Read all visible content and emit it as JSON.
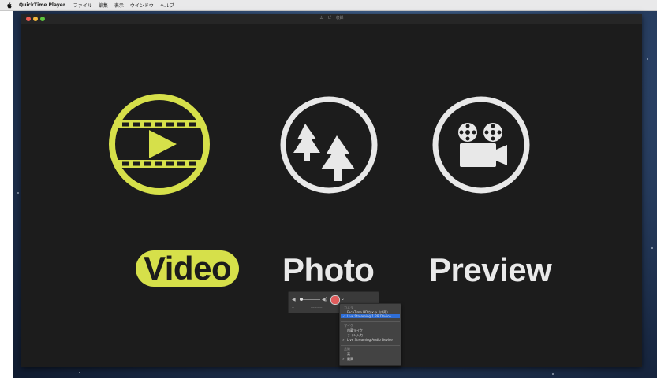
{
  "menubar": {
    "app_name": "QuickTime Player",
    "items": [
      "ファイル",
      "編集",
      "表示",
      "ウインドウ",
      "ヘルプ"
    ]
  },
  "window": {
    "title": "ムービー収録"
  },
  "main": {
    "tiles": [
      {
        "label": "Video",
        "icon": "film-play-icon",
        "highlighted": true
      },
      {
        "label": "Photo",
        "icon": "trees-icon",
        "highlighted": false
      },
      {
        "label": "Preview",
        "icon": "movie-camera-icon",
        "highlighted": false
      }
    ]
  },
  "controls": {
    "volume_low": "◀",
    "volume_high": "◀)",
    "chevron": "⌄",
    "sub_left": "--",
    "sub_right": "----------"
  },
  "record_menu": {
    "camera_header": "カメラ",
    "camera_items": [
      "FaceTime HDカメラ（内蔵）",
      "Live Streaming 1 RR Device"
    ],
    "camera_selected": 1,
    "mic_header": "マイク",
    "mic_items": [
      "内蔵マイク",
      "ライン入力",
      "Live Streaming Audio Device"
    ],
    "mic_checked": 2,
    "quality_header": "品質",
    "quality_items": [
      "高",
      "最高"
    ],
    "quality_checked": 1,
    "check_mark": "✓"
  },
  "colors": {
    "accent_yellow": "#d6e04a",
    "window_bg": "#1c1c1c",
    "menu_selected": "#2f6ed6"
  }
}
